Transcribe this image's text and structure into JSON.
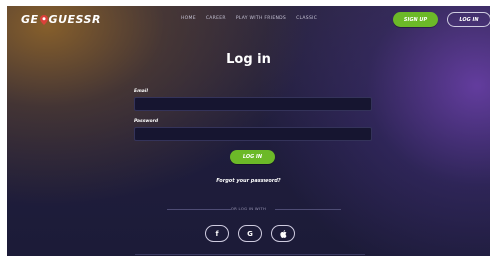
{
  "header": {
    "logo": {
      "left": "GE",
      "right": "GUESSR",
      "pin_color": "#d9413a"
    },
    "nav": [
      {
        "label": "HOME"
      },
      {
        "label": "CAREER"
      },
      {
        "label": "PLAY WITH FRIENDS"
      },
      {
        "label": "CLASSIC"
      }
    ],
    "signup_label": "SIGN UP",
    "login_label": "LOG IN"
  },
  "form": {
    "title": "Log in",
    "email_label": "Email",
    "email_value": "",
    "password_label": "Password",
    "password_value": "",
    "submit_label": "LOG IN",
    "forgot_label": "Forgot your password?",
    "divider_text": "OR LOG IN WITH"
  },
  "social": [
    {
      "icon": "facebook-icon",
      "glyph": "f"
    },
    {
      "icon": "google-icon",
      "glyph": "G"
    },
    {
      "icon": "apple-icon",
      "glyph": ""
    }
  ],
  "colors": {
    "accent_green": "#6cb928",
    "background_dark": "#1f1d3c"
  }
}
